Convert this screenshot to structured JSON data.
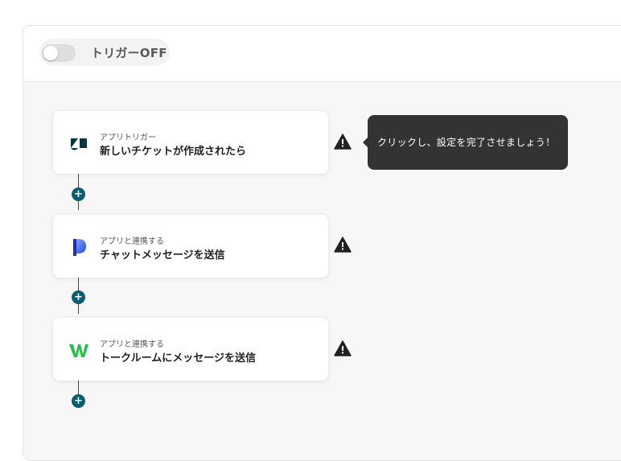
{
  "header": {
    "trigger_toggle_label": "トリガーOFF",
    "trigger_state": "off"
  },
  "steps": [
    {
      "type_label": "アプリトリガー",
      "title": "新しいチケットが作成されたら",
      "icon": "zendesk-logo-icon",
      "warning": true
    },
    {
      "type_label": "アプリと連携する",
      "title": "チャットメッセージを送信",
      "icon": "dialpad-logo-icon",
      "warning": true
    },
    {
      "type_label": "アプリと連携する",
      "title": "トークルームにメッセージを送信",
      "icon": "lineworks-logo-icon",
      "warning": true
    }
  ],
  "tooltip": {
    "text": "クリックし、設定を完了させましょう！"
  },
  "add_step_symbol": "+",
  "colors": {
    "accent": "#0d5d70",
    "tooltip_bg": "#333333",
    "canvas_bg": "#f7f7f7",
    "warning": "#222222"
  }
}
